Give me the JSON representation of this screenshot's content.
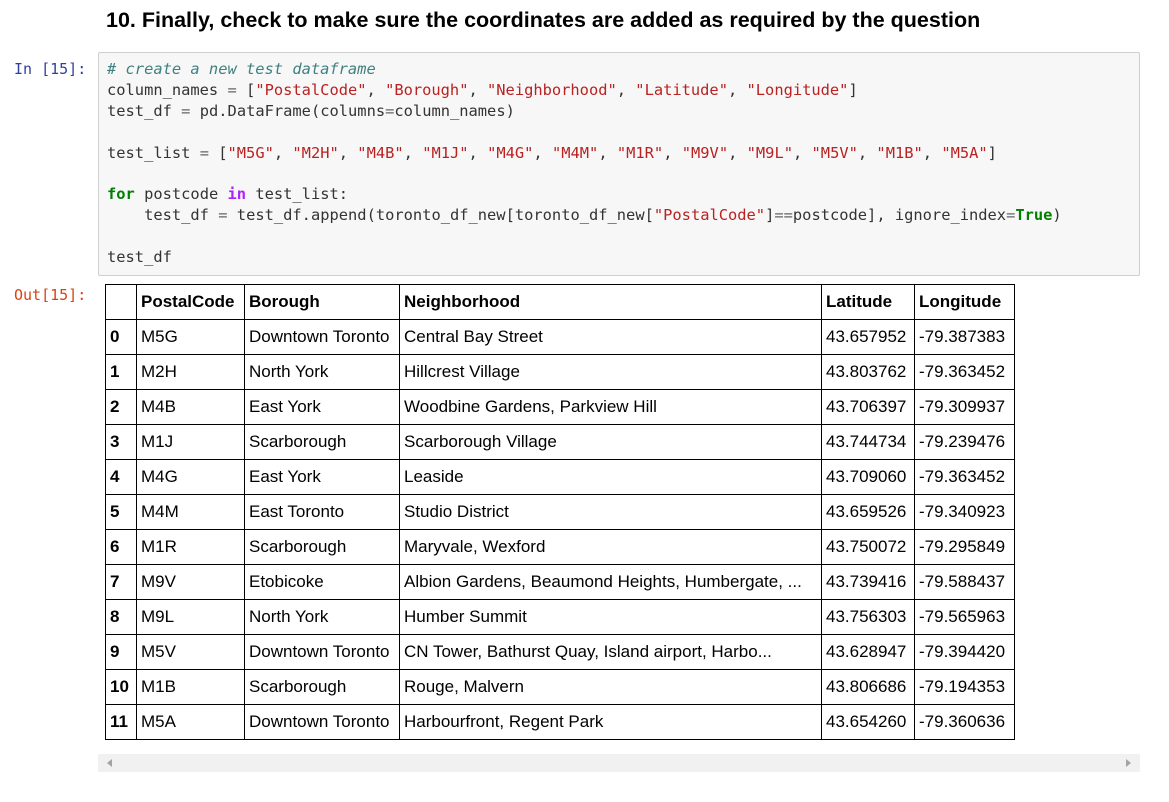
{
  "heading": "10. Finally, check to make sure the coordinates are added as required by the question",
  "input_prompt": "In [15]:",
  "output_prompt": "Out[15]:",
  "code_lines": [
    "# create a new test dataframe",
    "column_names = [\"PostalCode\", \"Borough\", \"Neighborhood\", \"Latitude\", \"Longitude\"]",
    "test_df = pd.DataFrame(columns=column_names)",
    "",
    "test_list = [\"M5G\", \"M2H\", \"M4B\", \"M1J\", \"M4G\", \"M4M\", \"M1R\", \"M9V\", \"M9L\", \"M5V\", \"M1B\", \"M5A\"]",
    "",
    "for postcode in test_list:",
    "    test_df = test_df.append(toronto_df_new[toronto_df_new[\"PostalCode\"]==postcode], ignore_index=True)",
    "",
    "test_df"
  ],
  "table": {
    "columns": [
      "",
      "PostalCode",
      "Borough",
      "Neighborhood",
      "Latitude",
      "Longitude"
    ],
    "rows": [
      [
        "0",
        "M5G",
        "Downtown Toronto",
        "Central Bay Street",
        "43.657952",
        "-79.387383"
      ],
      [
        "1",
        "M2H",
        "North York",
        "Hillcrest Village",
        "43.803762",
        "-79.363452"
      ],
      [
        "2",
        "M4B",
        "East York",
        "Woodbine Gardens, Parkview Hill",
        "43.706397",
        "-79.309937"
      ],
      [
        "3",
        "M1J",
        "Scarborough",
        "Scarborough Village",
        "43.744734",
        "-79.239476"
      ],
      [
        "4",
        "M4G",
        "East York",
        "Leaside",
        "43.709060",
        "-79.363452"
      ],
      [
        "5",
        "M4M",
        "East Toronto",
        "Studio District",
        "43.659526",
        "-79.340923"
      ],
      [
        "6",
        "M1R",
        "Scarborough",
        "Maryvale, Wexford",
        "43.750072",
        "-79.295849"
      ],
      [
        "7",
        "M9V",
        "Etobicoke",
        "Albion Gardens, Beaumond Heights, Humbergate, ...",
        "43.739416",
        "-79.588437"
      ],
      [
        "8",
        "M9L",
        "North York",
        "Humber Summit",
        "43.756303",
        "-79.565963"
      ],
      [
        "9",
        "M5V",
        "Downtown Toronto",
        "CN Tower, Bathurst Quay, Island airport, Harbo...",
        "43.628947",
        "-79.394420"
      ],
      [
        "10",
        "M1B",
        "Scarborough",
        "Rouge, Malvern",
        "43.806686",
        "-79.194353"
      ],
      [
        "11",
        "M5A",
        "Downtown Toronto",
        "Harbourfront, Regent Park",
        "43.654260",
        "-79.360636"
      ]
    ]
  },
  "colors": {
    "input_prompt": "#303F9F",
    "output_prompt": "#D84315",
    "code_background": "#f7f7f7",
    "comment": "#408080",
    "string": "#BA2121",
    "keyword": "#008000"
  }
}
